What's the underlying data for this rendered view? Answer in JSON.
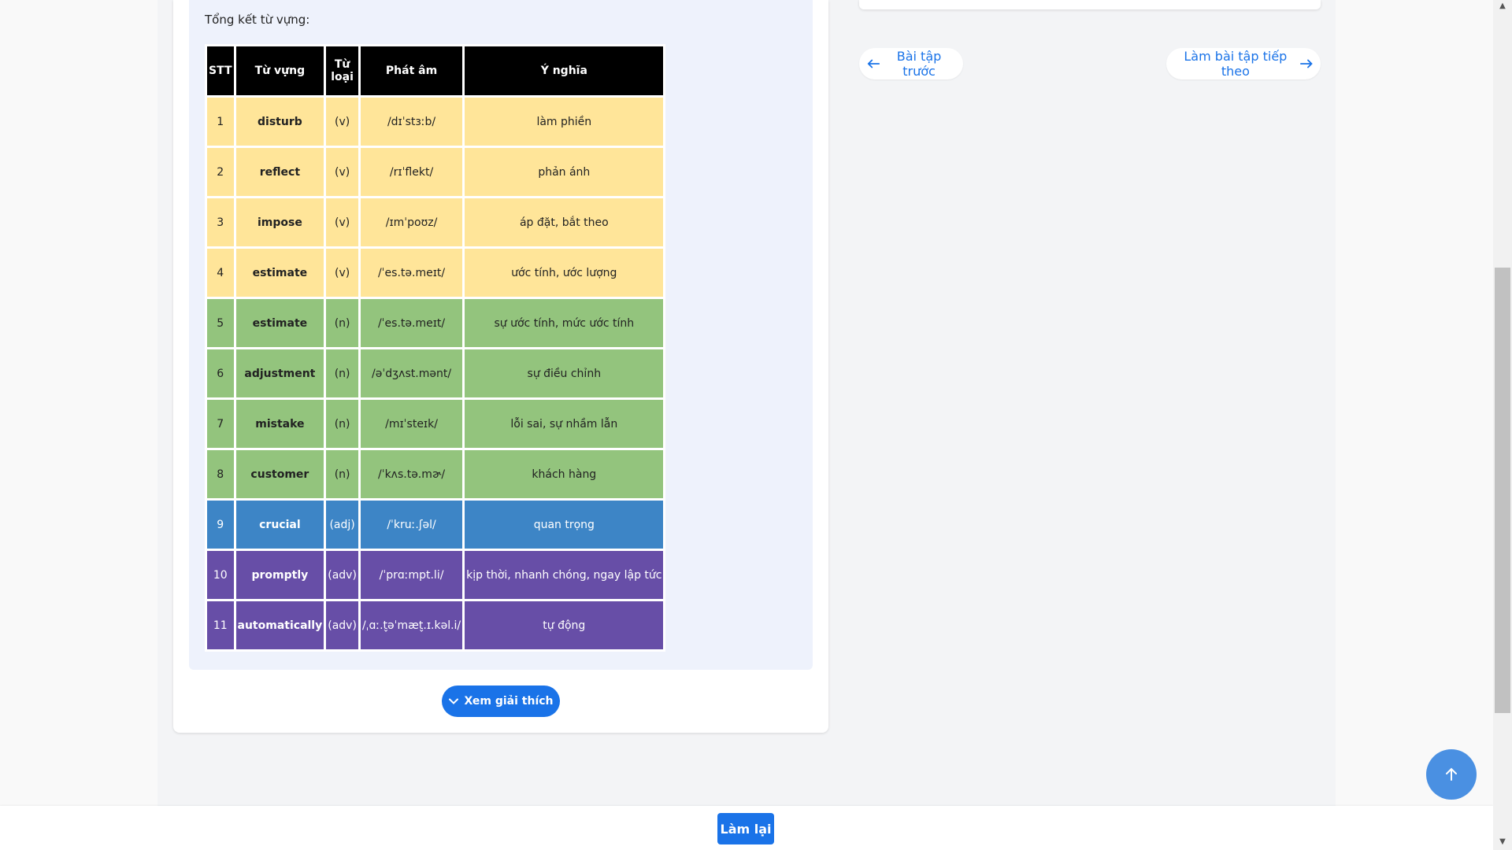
{
  "vocab_section": {
    "heading": "Tổng kết từ vựng:",
    "columns": [
      "STT",
      "Từ vựng",
      "Từ loại",
      "Phát âm",
      "Ý nghĩa"
    ],
    "rows": [
      {
        "no": "1",
        "word": "disturb",
        "pos": "(v)",
        "ipa": "/dɪˈstɜːb/",
        "meaning": "làm phiền"
      },
      {
        "no": "2",
        "word": "reflect",
        "pos": "(v)",
        "ipa": "/rɪˈflekt/",
        "meaning": "phản ánh"
      },
      {
        "no": "3",
        "word": "impose",
        "pos": "(v)",
        "ipa": "/ɪmˈpoʊz/",
        "meaning": "áp đặt, bắt theo"
      },
      {
        "no": "4",
        "word": "estimate",
        "pos": "(v)",
        "ipa": "/ˈes.tə.meɪt/",
        "meaning": "ước tính, ước lượng"
      },
      {
        "no": "5",
        "word": "estimate",
        "pos": "(n)",
        "ipa": "/ˈes.tə.meɪt/",
        "meaning": "sự ước tính, mức ước tính"
      },
      {
        "no": "6",
        "word": "adjustment",
        "pos": "(n)",
        "ipa": "/əˈdʒʌst.mənt/",
        "meaning": "sự điều chỉnh"
      },
      {
        "no": "7",
        "word": "mistake",
        "pos": "(n)",
        "ipa": "/mɪˈsteɪk/",
        "meaning": "lỗi sai, sự nhầm lẫn"
      },
      {
        "no": "8",
        "word": "customer",
        "pos": "(n)",
        "ipa": "/ˈkʌs.tə.mɚ/",
        "meaning": "khách hàng"
      },
      {
        "no": "9",
        "word": "crucial",
        "pos": "(adj)",
        "ipa": "/ˈkruː.ʃəl/",
        "meaning": "quan trọng"
      },
      {
        "no": "10",
        "word": "promptly",
        "pos": "(adv)",
        "ipa": "/ˈprɑːmpt.li/",
        "meaning": "kịp thời, nhanh chóng, ngay lập tức"
      },
      {
        "no": "11",
        "word": "automatically",
        "pos": "(adv)",
        "ipa": "/ˌɑː.t̬əˈmæt̬.ɪ.kəl.i/",
        "meaning": "tự động"
      }
    ],
    "row_colors": {
      "yellow": "#ffe599",
      "green": "#93c47d",
      "blue": "#3d85c6",
      "purple": "#674ea7"
    }
  },
  "explain_button": {
    "label": "Xem giải thích",
    "icon": "chevron-down-icon"
  },
  "navigation": {
    "prev_label": "Bài tập trước",
    "next_label": "Làm bài tập tiếp theo",
    "accent": "#1a73e8"
  },
  "scroll_top": {
    "icon": "arrow-up-icon",
    "color": "#4a90e2"
  },
  "bottom_bar": {
    "retry_label": "Làm lại"
  }
}
